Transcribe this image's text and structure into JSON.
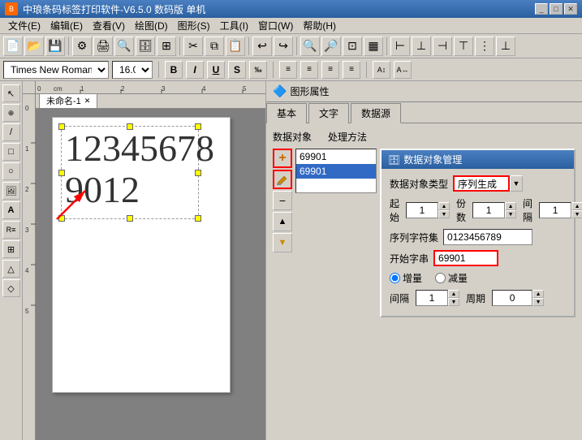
{
  "titleBar": {
    "title": "中琅条码标签打印软件-V6.5.0 数码版 单机",
    "icon": "B"
  },
  "menuBar": {
    "items": [
      {
        "label": "文件(E)",
        "id": "file"
      },
      {
        "label": "编辑(E)",
        "id": "edit"
      },
      {
        "label": "查看(V)",
        "id": "view"
      },
      {
        "label": "绘图(D)",
        "id": "draw"
      },
      {
        "label": "图形(S)",
        "id": "shape"
      },
      {
        "label": "工具(I)",
        "id": "tools"
      },
      {
        "label": "窗口(W)",
        "id": "window"
      },
      {
        "label": "帮助(H)",
        "id": "help"
      }
    ]
  },
  "fontToolbar": {
    "fontName": "Times New Roman",
    "fontSize": "16.0",
    "boldLabel": "B",
    "italicLabel": "I",
    "underlineLabel": "U",
    "strikeLabel": "S",
    "superLabel": "‰"
  },
  "canvas": {
    "tabName": "未命名-1",
    "text1": "12345678",
    "text2": "9012",
    "rulerUnit": "cm"
  },
  "graphicsPanel": {
    "title": "图形属性",
    "tabs": [
      {
        "label": "基本",
        "id": "basic"
      },
      {
        "label": "文字",
        "id": "text"
      },
      {
        "label": "数据源",
        "id": "datasource",
        "active": true
      }
    ],
    "dataSource": {
      "sectionLabel": "数据对象",
      "processingLabel": "处理方法",
      "items": [
        {
          "value": "69901",
          "selected": false
        },
        {
          "value": "69901",
          "selected": true
        }
      ],
      "addBtn": "+",
      "editBtn": "✎",
      "deleteBtn": "−",
      "upBtn": "▲",
      "downBtn": "▼"
    },
    "objectManager": {
      "title": "数据对象管理",
      "typeLabel": "数据对象类型",
      "typeValue": "序列生成",
      "startLabel": "起始",
      "startValue": "1",
      "copiesLabel": "份数",
      "copiesValue": "1",
      "intervalLabel": "间隔",
      "intervalValue": "1",
      "charsetLabel": "序列字符集",
      "charsetValue": "0123456789",
      "startStringLabel": "开始字串",
      "startStringValue": "69901",
      "incrementLabel": "增量",
      "decrementLabel": "减量",
      "intervalLabel2": "间隔",
      "intervalValue2": "1",
      "periodLabel": "周期",
      "periodValue": "0"
    }
  }
}
